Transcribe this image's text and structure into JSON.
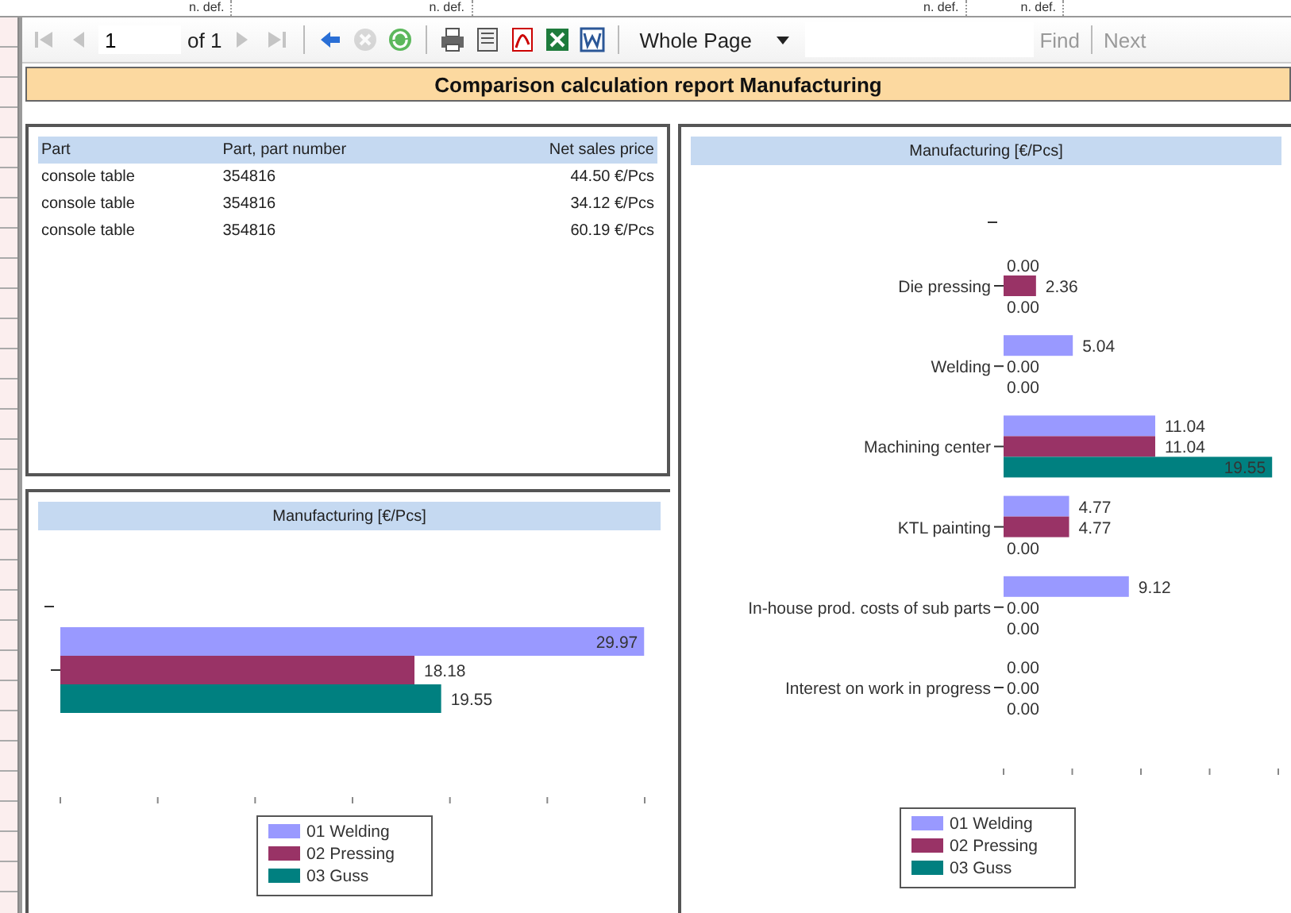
{
  "background_sheet": {
    "cells": [
      "n. def.",
      "n. def.",
      "n. def.",
      "n. def."
    ]
  },
  "toolbar": {
    "nav_before": [
      {
        "kind": "first",
        "disabled": true
      },
      {
        "kind": "prev",
        "disabled": true
      }
    ],
    "page": {
      "value": "1",
      "of_label": "of 1"
    },
    "nav_after": [
      {
        "kind": "next",
        "disabled": true
      },
      {
        "kind": "last",
        "disabled": true
      },
      {
        "kind": "back",
        "disabled": false
      },
      {
        "kind": "stop",
        "disabled": true
      },
      {
        "kind": "refresh",
        "disabled": false
      },
      {
        "kind": "print",
        "disabled": false
      },
      {
        "kind": "layout",
        "disabled": false
      },
      {
        "kind": "pdf",
        "disabled": false
      },
      {
        "kind": "excel",
        "disabled": false
      },
      {
        "kind": "word",
        "disabled": false
      }
    ],
    "zoom": {
      "value": "Whole Page"
    },
    "find": {
      "label": "Find",
      "disabled": true
    },
    "find_next": {
      "label": "Next",
      "disabled": true
    }
  },
  "report": {
    "title": "Comparison calculation report Manufacturing",
    "table": {
      "columns": [
        "Part",
        "Part, part number",
        "Net sales price"
      ],
      "rows": [
        [
          "console table",
          "354816",
          "44.50 €/Pcs"
        ],
        [
          "console table",
          "354816",
          "34.12 €/Pcs"
        ],
        [
          "console table",
          "354816",
          "60.19 €/Pcs"
        ]
      ]
    },
    "chart_by_cost_type": {
      "title": "Manufacturing [€/Pcs]",
      "chart_data": {
        "type": "bar",
        "orientation": "horizontal",
        "categories": [
          "Die pressing",
          "Welding",
          "Machining center",
          "KTL painting",
          "In-house prod. costs of sub parts",
          "Interest on work in progress"
        ],
        "legend": true,
        "series": [
          {
            "name": "01 Welding",
            "color": "#9999ff",
            "values": [
              0,
              5.04,
              11.04,
              4.77,
              9.12,
              0
            ],
            "value_labels": [
              "0.00",
              "5.04",
              "11.04",
              "4.77",
              "9.12",
              "0.00"
            ]
          },
          {
            "name": "02 Pressing",
            "color": "#993366",
            "values": [
              2.36,
              0,
              11.04,
              4.77,
              0,
              0
            ],
            "value_labels": [
              "2.36",
              "0.00",
              "11.04",
              "4.77",
              "0.00",
              "0.00"
            ]
          },
          {
            "name": "03 Guss",
            "color": "#008080",
            "values": [
              0,
              0,
              19.55,
              0,
              0,
              0
            ],
            "value_labels": [
              "0.00",
              "0.00",
              "19.55",
              "0.00",
              "0.00",
              "0.00"
            ]
          }
        ]
      }
    },
    "chart_total": {
      "title": "Manufacturing [€/Pcs]",
      "chart_data": {
        "type": "bar",
        "orientation": "horizontal",
        "legend": true,
        "series": [
          {
            "name": "01 Welding",
            "color": "#9999ff",
            "values": [
              29.97
            ],
            "value_labels": [
              "29.97"
            ]
          },
          {
            "name": "02 Pressing",
            "color": "#993366",
            "values": [
              18.18
            ],
            "value_labels": [
              "18.18"
            ]
          },
          {
            "name": "03 Guss",
            "color": "#008080",
            "values": [
              19.55
            ],
            "value_labels": [
              "19.55"
            ]
          }
        ]
      }
    }
  }
}
